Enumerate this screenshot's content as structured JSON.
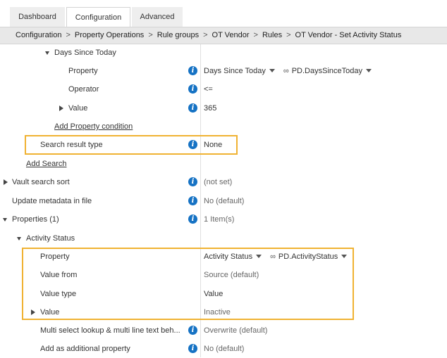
{
  "tabs": [
    {
      "label": "Dashboard"
    },
    {
      "label": "Configuration"
    },
    {
      "label": "Advanced"
    }
  ],
  "breadcrumb": [
    "Configuration",
    "Property Operations",
    "Rule groups",
    "OT Vendor",
    "Rules",
    "OT Vendor - Set Activity Status"
  ],
  "breadcrumb_separator": ">",
  "info_glyph": "i",
  "rows": {
    "days_since_today": {
      "label": "Days Since Today"
    },
    "property": {
      "label": "Property",
      "value": "Days Since Today",
      "alias": "PD.DaysSinceToday"
    },
    "operator": {
      "label": "Operator",
      "value": "<="
    },
    "value": {
      "label": "Value",
      "value": "365"
    },
    "add_property_condition": {
      "label": "Add Property condition"
    },
    "search_result_type": {
      "label": "Search result type",
      "value": "None"
    },
    "add_search": {
      "label": "Add Search"
    },
    "vault_search_sort": {
      "label": "Vault search sort",
      "value": "(not set)"
    },
    "update_metadata": {
      "label": "Update metadata in file",
      "value": "No (default)"
    },
    "properties": {
      "label": "Properties (1)",
      "value": "1 Item(s)"
    },
    "activity_status": {
      "label": "Activity Status"
    },
    "as_property": {
      "label": "Property",
      "value": "Activity Status",
      "alias": "PD.ActivityStatus"
    },
    "value_from": {
      "label": "Value from",
      "value": "Source (default)"
    },
    "value_type": {
      "label": "Value type",
      "value": "Value"
    },
    "as_value": {
      "label": "Value",
      "value": "Inactive"
    },
    "multi_select": {
      "label": "Multi select lookup & multi line text beh...",
      "value": "Overwrite (default)"
    },
    "add_additional": {
      "label": "Add as additional property",
      "value": "No (default)"
    }
  },
  "colors": {
    "highlight": "#f0b232",
    "info_icon": "#1572c4",
    "breadcrumb_bg": "#e8e8e8"
  }
}
